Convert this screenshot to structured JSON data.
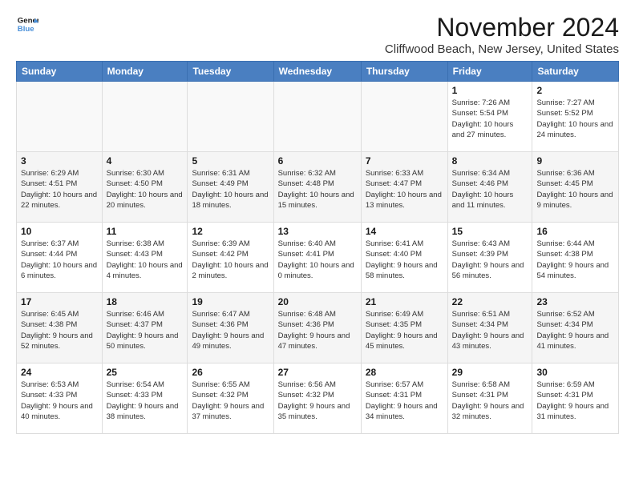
{
  "logo": {
    "line1": "General",
    "line2": "Blue"
  },
  "title": "November 2024",
  "location": "Cliffwood Beach, New Jersey, United States",
  "days_of_week": [
    "Sunday",
    "Monday",
    "Tuesday",
    "Wednesday",
    "Thursday",
    "Friday",
    "Saturday"
  ],
  "weeks": [
    [
      {
        "day": "",
        "info": ""
      },
      {
        "day": "",
        "info": ""
      },
      {
        "day": "",
        "info": ""
      },
      {
        "day": "",
        "info": ""
      },
      {
        "day": "",
        "info": ""
      },
      {
        "day": "1",
        "info": "Sunrise: 7:26 AM\nSunset: 5:54 PM\nDaylight: 10 hours and 27 minutes."
      },
      {
        "day": "2",
        "info": "Sunrise: 7:27 AM\nSunset: 5:52 PM\nDaylight: 10 hours and 24 minutes."
      }
    ],
    [
      {
        "day": "3",
        "info": "Sunrise: 6:29 AM\nSunset: 4:51 PM\nDaylight: 10 hours and 22 minutes."
      },
      {
        "day": "4",
        "info": "Sunrise: 6:30 AM\nSunset: 4:50 PM\nDaylight: 10 hours and 20 minutes."
      },
      {
        "day": "5",
        "info": "Sunrise: 6:31 AM\nSunset: 4:49 PM\nDaylight: 10 hours and 18 minutes."
      },
      {
        "day": "6",
        "info": "Sunrise: 6:32 AM\nSunset: 4:48 PM\nDaylight: 10 hours and 15 minutes."
      },
      {
        "day": "7",
        "info": "Sunrise: 6:33 AM\nSunset: 4:47 PM\nDaylight: 10 hours and 13 minutes."
      },
      {
        "day": "8",
        "info": "Sunrise: 6:34 AM\nSunset: 4:46 PM\nDaylight: 10 hours and 11 minutes."
      },
      {
        "day": "9",
        "info": "Sunrise: 6:36 AM\nSunset: 4:45 PM\nDaylight: 10 hours and 9 minutes."
      }
    ],
    [
      {
        "day": "10",
        "info": "Sunrise: 6:37 AM\nSunset: 4:44 PM\nDaylight: 10 hours and 6 minutes."
      },
      {
        "day": "11",
        "info": "Sunrise: 6:38 AM\nSunset: 4:43 PM\nDaylight: 10 hours and 4 minutes."
      },
      {
        "day": "12",
        "info": "Sunrise: 6:39 AM\nSunset: 4:42 PM\nDaylight: 10 hours and 2 minutes."
      },
      {
        "day": "13",
        "info": "Sunrise: 6:40 AM\nSunset: 4:41 PM\nDaylight: 10 hours and 0 minutes."
      },
      {
        "day": "14",
        "info": "Sunrise: 6:41 AM\nSunset: 4:40 PM\nDaylight: 9 hours and 58 minutes."
      },
      {
        "day": "15",
        "info": "Sunrise: 6:43 AM\nSunset: 4:39 PM\nDaylight: 9 hours and 56 minutes."
      },
      {
        "day": "16",
        "info": "Sunrise: 6:44 AM\nSunset: 4:38 PM\nDaylight: 9 hours and 54 minutes."
      }
    ],
    [
      {
        "day": "17",
        "info": "Sunrise: 6:45 AM\nSunset: 4:38 PM\nDaylight: 9 hours and 52 minutes."
      },
      {
        "day": "18",
        "info": "Sunrise: 6:46 AM\nSunset: 4:37 PM\nDaylight: 9 hours and 50 minutes."
      },
      {
        "day": "19",
        "info": "Sunrise: 6:47 AM\nSunset: 4:36 PM\nDaylight: 9 hours and 49 minutes."
      },
      {
        "day": "20",
        "info": "Sunrise: 6:48 AM\nSunset: 4:36 PM\nDaylight: 9 hours and 47 minutes."
      },
      {
        "day": "21",
        "info": "Sunrise: 6:49 AM\nSunset: 4:35 PM\nDaylight: 9 hours and 45 minutes."
      },
      {
        "day": "22",
        "info": "Sunrise: 6:51 AM\nSunset: 4:34 PM\nDaylight: 9 hours and 43 minutes."
      },
      {
        "day": "23",
        "info": "Sunrise: 6:52 AM\nSunset: 4:34 PM\nDaylight: 9 hours and 41 minutes."
      }
    ],
    [
      {
        "day": "24",
        "info": "Sunrise: 6:53 AM\nSunset: 4:33 PM\nDaylight: 9 hours and 40 minutes."
      },
      {
        "day": "25",
        "info": "Sunrise: 6:54 AM\nSunset: 4:33 PM\nDaylight: 9 hours and 38 minutes."
      },
      {
        "day": "26",
        "info": "Sunrise: 6:55 AM\nSunset: 4:32 PM\nDaylight: 9 hours and 37 minutes."
      },
      {
        "day": "27",
        "info": "Sunrise: 6:56 AM\nSunset: 4:32 PM\nDaylight: 9 hours and 35 minutes."
      },
      {
        "day": "28",
        "info": "Sunrise: 6:57 AM\nSunset: 4:31 PM\nDaylight: 9 hours and 34 minutes."
      },
      {
        "day": "29",
        "info": "Sunrise: 6:58 AM\nSunset: 4:31 PM\nDaylight: 9 hours and 32 minutes."
      },
      {
        "day": "30",
        "info": "Sunrise: 6:59 AM\nSunset: 4:31 PM\nDaylight: 9 hours and 31 minutes."
      }
    ]
  ]
}
